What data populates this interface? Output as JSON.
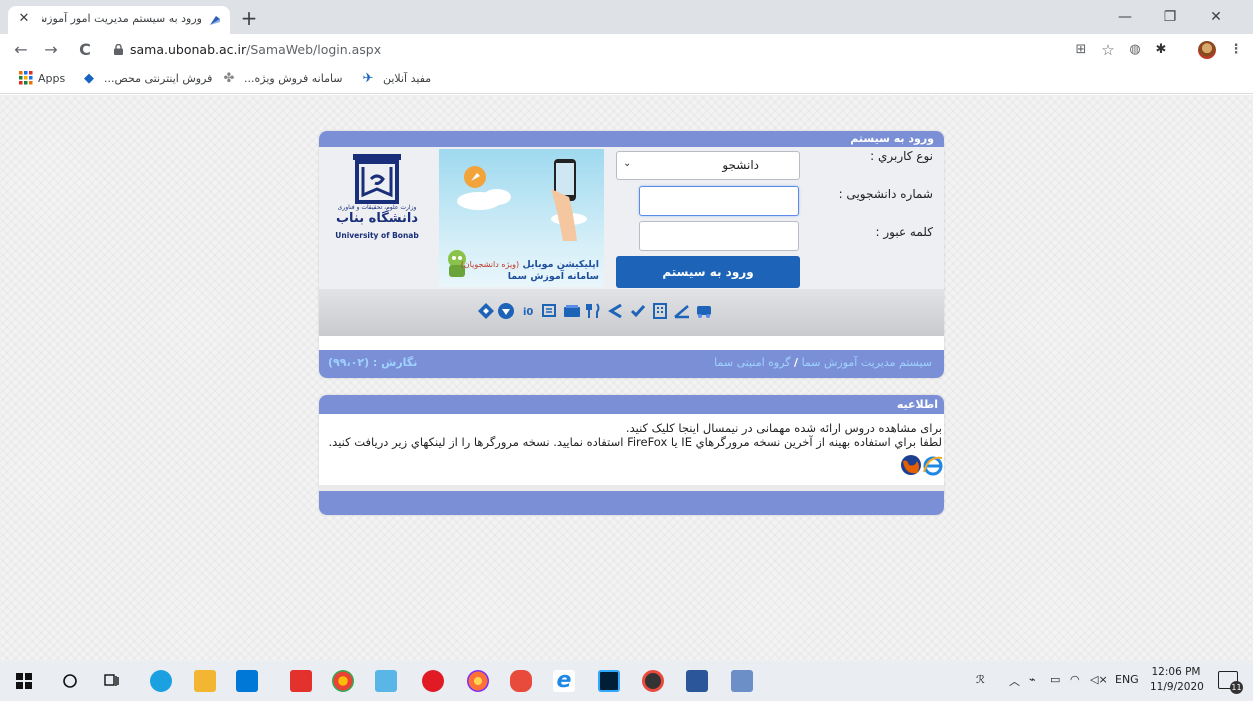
{
  "browser": {
    "tab": {
      "title": "ورود به سیستم مدیریت امور آموزش",
      "close_glyph": "✕"
    },
    "new_tab_glyph": "+",
    "window_controls": {
      "minimize": "—",
      "maximize": "❐",
      "close": "✕"
    },
    "nav": {
      "back": "←",
      "forward": "→",
      "reload": "C"
    },
    "url": {
      "host": "sama.ubonab.ac.ir",
      "path": "/SamaWeb/login.aspx"
    },
    "bookmarks": [
      {
        "label": "Apps",
        "icon": "apps-grid-icon"
      },
      {
        "label": "فروش اینترنتی محص...",
        "icon": "bookmark-icon"
      },
      {
        "label": "سامانه فروش ویژه...",
        "icon": "bookmark-icon"
      },
      {
        "label": "مفید آنلاین",
        "icon": "bookmark-icon"
      }
    ]
  },
  "login": {
    "header": "ورود به سیستم",
    "user_type_label": "نوع كاربري :",
    "user_type_value": "دانشجو",
    "student_no_label": "شماره دانشجویی :",
    "password_label": "کلمه عبور :",
    "submit": "ورود به سیستم",
    "banner_text": "اپلیکیشن موبایل",
    "banner_sub": "(ویژه دانشجویان)",
    "banner_text2": "سامانه آموزش سما",
    "university": {
      "ministry": "وزارت علوم، تحقیقات و فناوری",
      "name_fa": "دانشگاه بناب",
      "name_en": "University of Bonab"
    },
    "footer_version": "نگارش : (۹۹،۰۲)",
    "footer_system": "سیستم مدیریت آموزش سما",
    "footer_sep": "/",
    "footer_group": "گروه امنیتی سما"
  },
  "notice": {
    "header": "اطلاعیه",
    "line1": "برای مشاهده دروس ارائه شده مهمانی در نیمسال اینجا کلیک کنید.",
    "line2": "لطفا براي استفاده بهينه از آخرين نسخه مرورگرهاي IE يا FireFox استفاده نماييد. نسخه مرورگرها را از لينكهاي زير دريافت كنيد."
  },
  "taskbar": {
    "tray": {
      "lang": "ENG",
      "time": "12:06 PM",
      "date": "11/9/2020",
      "notifications": "11"
    }
  },
  "colors": {
    "panel_header": "#7b8fd6",
    "login_button": "#1d63b8",
    "footer_text": "#9fd3ff"
  }
}
